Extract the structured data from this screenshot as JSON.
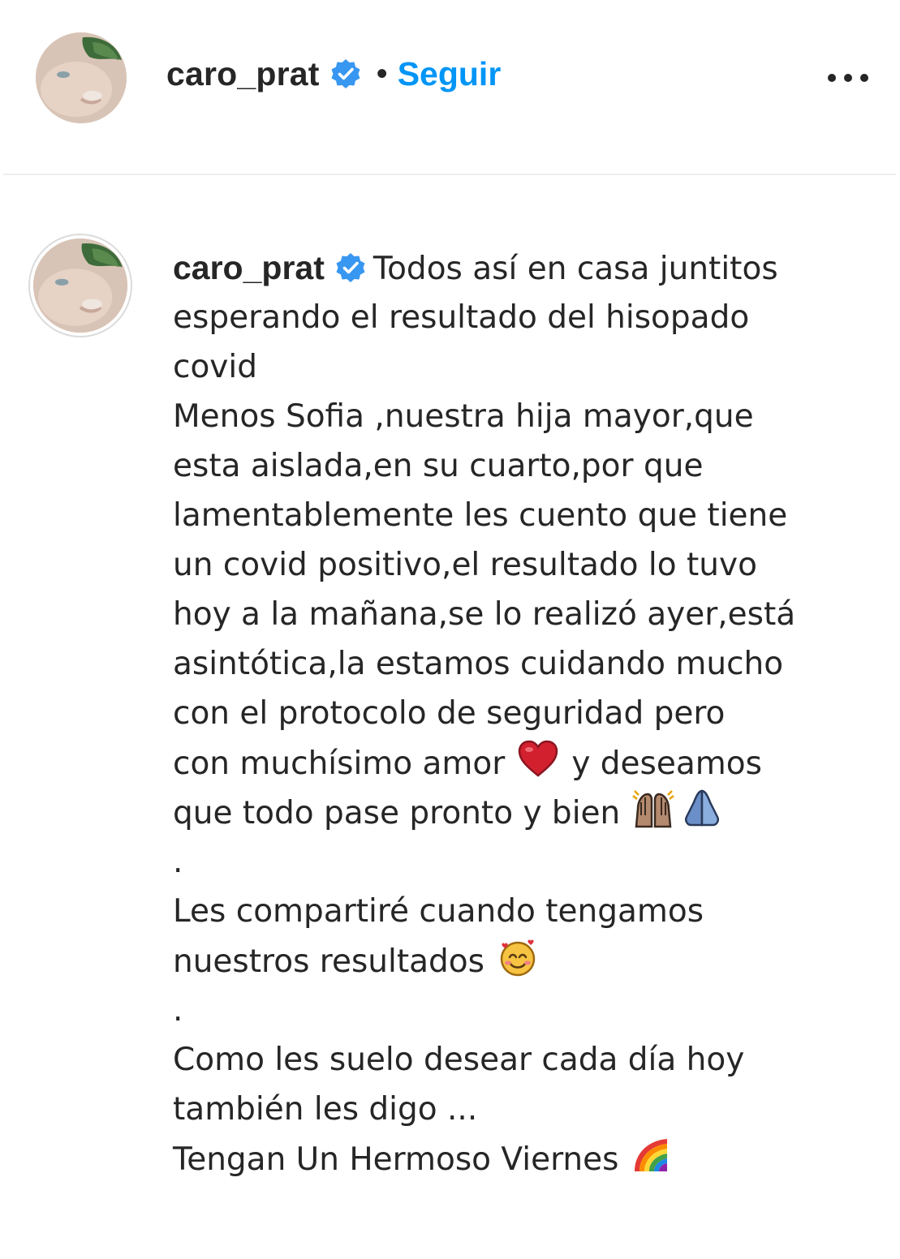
{
  "header": {
    "avatar_icon": "profile-photo",
    "username": "caro_prat",
    "verified_icon": "verified-badge-icon",
    "separator": "•",
    "follow_label": "Seguir",
    "more_icon": "more-options-icon"
  },
  "caption": {
    "username": "caro_prat",
    "lines": [
      "Todos así en casa juntitos",
      "esperando el resultado del hisopado",
      "covid",
      "Menos Sofia ,nuestra hija mayor,que",
      "esta aislada,en su cuarto,por que",
      "lamentablemente les cuento que tiene",
      "un covid positivo,el resultado lo tuvo",
      "hoy a la mañana,se lo realizó ayer,está",
      "asintótica,la estamos cuidando mucho",
      "con el protocolo de seguridad pero",
      "con muchísimo amor",
      "y deseamos",
      "que todo pase pronto y bien",
      ".",
      "Les compartiré cuando tengamos",
      "nuestros resultados",
      ".",
      "Como les suelo desear cada día hoy",
      "también les digo ...",
      "Tengan Un Hermoso Viernes"
    ],
    "emojis": [
      "heart-icon",
      "raising-hands-icon",
      "folded-hands-icon",
      "smiling-face-with-hearts-icon",
      "rainbow-icon"
    ]
  },
  "colors": {
    "link_blue": "#0095f6",
    "text": "#262626",
    "verified_blue": "#3897f0",
    "divider": "#efefef"
  }
}
